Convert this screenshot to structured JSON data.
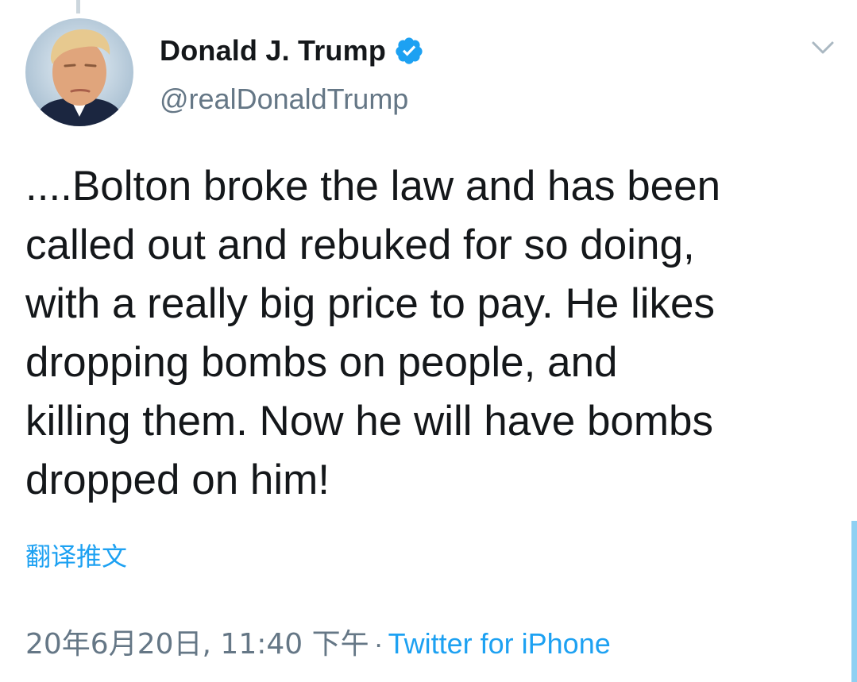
{
  "author": {
    "display_name": "Donald J. Trump",
    "handle": "@realDonaldTrump",
    "verified_icon": "verified-badge-icon",
    "avatar_icon": "profile-avatar"
  },
  "menu": {
    "icon": "chevron-down-icon"
  },
  "tweet": {
    "text": "....Bolton broke the law and has been\ncalled out and rebuked for so doing,\nwith a really big price to pay. He likes\ndropping bombs on people, and\nkilling them. Now he will have bombs\ndropped on him!"
  },
  "translate": {
    "label": "翻译推文"
  },
  "meta": {
    "datetime": "20年6月20日, 11:40 下午",
    "separator": "·",
    "source": "Twitter for iPhone"
  },
  "colors": {
    "accent": "#1da1f2",
    "text": "#14171a",
    "secondary": "#657786"
  }
}
